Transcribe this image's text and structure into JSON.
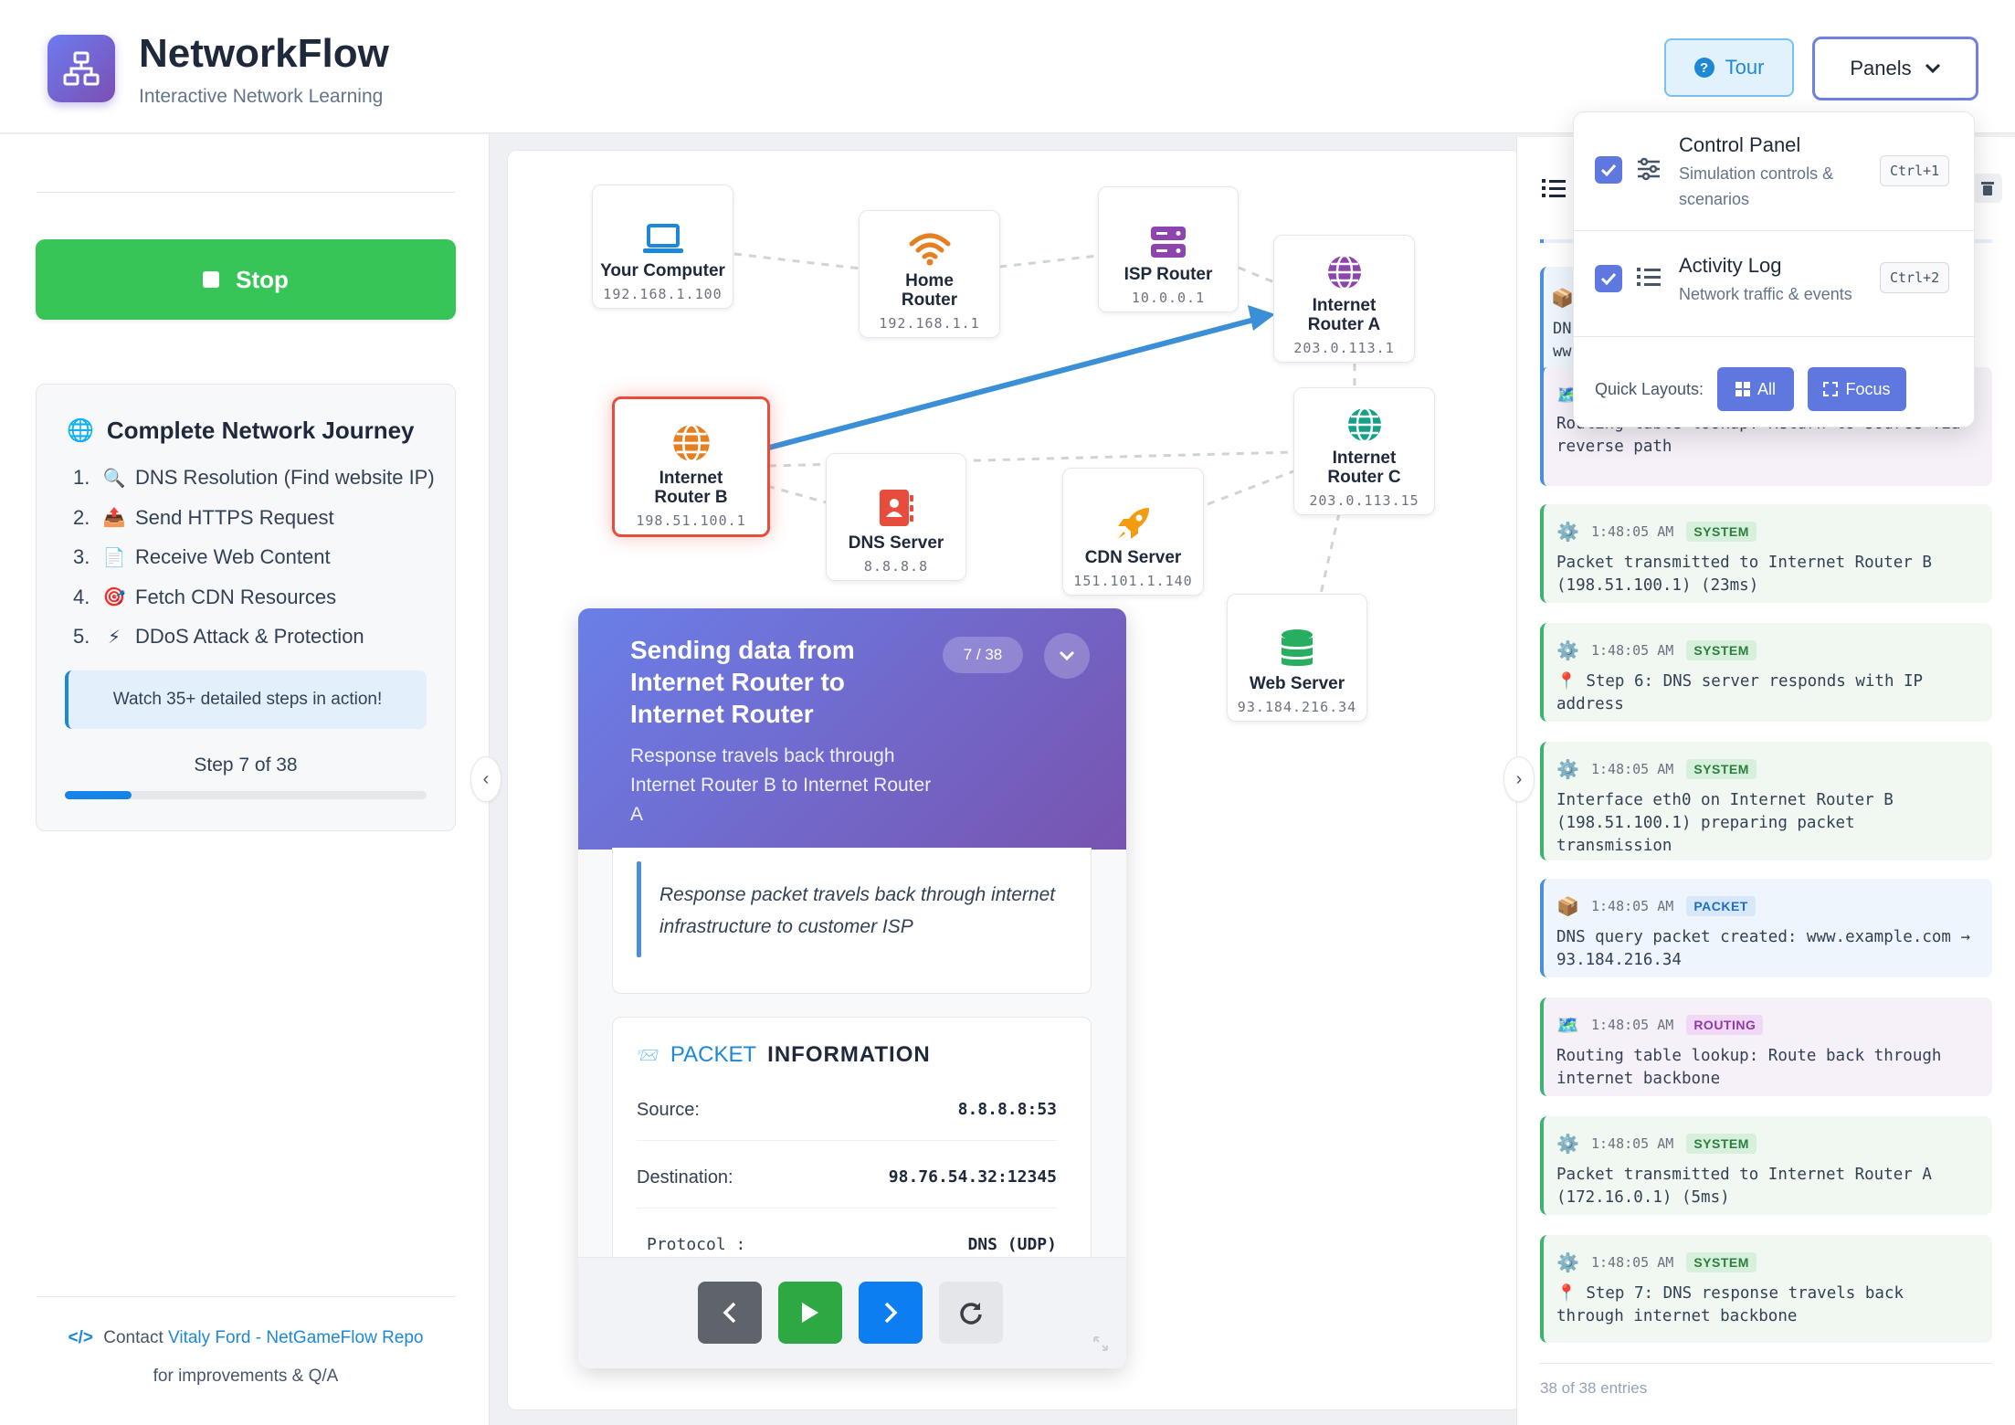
{
  "header": {
    "title": "NetworkFlow",
    "subtitle": "Interactive Network Learning",
    "tour_label": "Tour",
    "panels_label": "Panels"
  },
  "left": {
    "stop_label": "Stop",
    "journey_title": "Complete Network Journey",
    "journey_items": [
      {
        "num": "1.",
        "label": "DNS Resolution (Find website IP)"
      },
      {
        "num": "2.",
        "label": "Send HTTPS Request"
      },
      {
        "num": "3.",
        "label": "Receive Web Content"
      },
      {
        "num": "4.",
        "label": "Fetch CDN Resources"
      },
      {
        "num": "5.",
        "label": "DDoS Attack & Protection"
      }
    ],
    "note": "Watch 35+ detailed steps in action!",
    "step_count": "Step 7 of 38",
    "progress": 0.184,
    "contact_prefix": "Contact",
    "contact_link": "Vitaly Ford - NetGameFlow Repo",
    "contact_suffix": "for improvements & Q/A"
  },
  "nodes": [
    {
      "id": "your-computer",
      "label": "Your Computer",
      "ip": "192.168.1.100",
      "icon": "laptop-icon",
      "color": "#1e88d8"
    },
    {
      "id": "home-router",
      "label": "Home Router",
      "ip": "192.168.1.1",
      "icon": "wifi-icon",
      "color": "#e67e22"
    },
    {
      "id": "isp-router",
      "label": "ISP Router",
      "ip": "10.0.0.1",
      "icon": "server-icon",
      "color": "#8e44ad"
    },
    {
      "id": "internet-router-a",
      "label": "Internet Router A",
      "ip": "203.0.113.1",
      "icon": "globe-icon",
      "color": "#8e44ad"
    },
    {
      "id": "internet-router-b",
      "label": "Internet Router B",
      "ip": "198.51.100.1",
      "icon": "globe-icon",
      "color": "#e67e22"
    },
    {
      "id": "dns-server",
      "label": "DNS Server",
      "ip": "8.8.8.8",
      "icon": "address-book-icon",
      "color": "#e74c3c"
    },
    {
      "id": "cdn-server",
      "label": "CDN Server",
      "ip": "151.101.1.140",
      "icon": "rocket-icon",
      "color": "#f39c12"
    },
    {
      "id": "internet-router-c",
      "label": "Internet Router C",
      "ip": "203.0.113.15",
      "icon": "globe-icon",
      "color": "#16a085"
    },
    {
      "id": "web-server",
      "label": "Web Server",
      "ip": "93.184.216.34",
      "icon": "database-icon",
      "color": "#27ae60"
    }
  ],
  "step": {
    "title": "Sending data from Internet Router to Internet Router",
    "badge": "7 / 38",
    "description": "Response travels back through Internet Router B to Internet Router A",
    "quote": "Response packet travels back through internet infrastructure to customer ISP",
    "packet_word": "PACKET",
    "info_word": "INFORMATION",
    "rows": [
      {
        "label": "Source:",
        "value": "8.8.8.8:53"
      },
      {
        "label": "Destination:",
        "value": "98.76.54.32:12345"
      },
      {
        "label": "Protocol :",
        "value": "DNS (UDP)"
      }
    ]
  },
  "log": {
    "entries": [
      {
        "kind": "rt",
        "time": "",
        "tag": "",
        "icon": "map-icon",
        "message": "Routing table lookup: Return to source via reverse path"
      },
      {
        "kind": "sys",
        "time": "1:48:05 AM",
        "tag": "SYSTEM",
        "icon": "gear-icon",
        "message": "Packet transmitted to Internet Router B (198.51.100.1) (23ms)"
      },
      {
        "kind": "sys",
        "time": "1:48:05 AM",
        "tag": "SYSTEM",
        "icon": "gear-icon",
        "message": "📍 Step 6: DNS server responds with IP address"
      },
      {
        "kind": "sys",
        "time": "1:48:05 AM",
        "tag": "SYSTEM",
        "icon": "gear-icon",
        "message": "Interface eth0 on Internet Router B (198.51.100.1) preparing packet transmission"
      },
      {
        "kind": "pkt",
        "time": "1:48:05 AM",
        "tag": "PACKET",
        "icon": "package-icon",
        "message": "DNS query packet created: www.example.com → 93.184.216.34"
      },
      {
        "kind": "rt",
        "time": "1:48:05 AM",
        "tag": "ROUTING",
        "icon": "map-icon",
        "message": "Routing table lookup: Route back through internet backbone"
      },
      {
        "kind": "sys",
        "time": "1:48:05 AM",
        "tag": "SYSTEM",
        "icon": "gear-icon",
        "message": "Packet transmitted to Internet Router A (172.16.0.1) (5ms)"
      },
      {
        "kind": "sys",
        "time": "1:48:05 AM",
        "tag": "SYSTEM",
        "icon": "gear-icon",
        "message": "📍 Step 7: DNS response travels back through internet backbone"
      }
    ],
    "partial_top": "DN\nww",
    "footer": "38 of 38 entries"
  },
  "panels_menu": {
    "items": [
      {
        "title": "Control Panel",
        "sub": "Simulation controls & scenarios",
        "shortcut": "Ctrl+1",
        "checked": true
      },
      {
        "title": "Activity Log",
        "sub": "Network traffic & events",
        "shortcut": "Ctrl+2",
        "checked": true
      }
    ],
    "quick_label": "Quick Layouts:",
    "quick_all": "All",
    "quick_focus": "Focus"
  },
  "colors": {
    "accent": "#5e78e0",
    "stop": "#37c557",
    "packet_arrow": "#3b8fd6",
    "active_node": "#e74c3c"
  }
}
